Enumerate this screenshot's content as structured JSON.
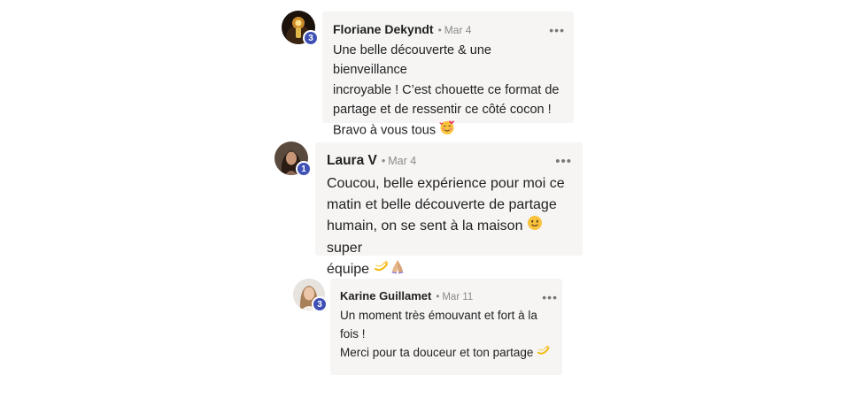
{
  "comments": [
    {
      "author": "Floriane Dekyndt",
      "date": "Mar 4",
      "level": "3",
      "more": "•••",
      "text": "Une belle découverte & une bienveillance\nincroyable ! C’est chouette ce format de\npartage et de ressentir ce côté cocon !\nBravo à vous tous",
      "emoji": "smiling-face-with-hearts-icon"
    },
    {
      "author": "Laura V",
      "date": "Mar 4",
      "level": "1",
      "more": "•••",
      "text_before": "Coucou, belle expérience pour moi ce\nmatin et belle découverte de partage\nhumain, on se sent à la maison ",
      "text_middle": " super\néquipe ",
      "emojis": [
        "slightly-smiling-face-icon",
        "dizzy-icon",
        "folded-hands-icon"
      ]
    },
    {
      "author": "Karine Guillamet",
      "date": "Mar 11",
      "level": "3",
      "more": "•••",
      "text": "Un moment très émouvant et fort à la\nfois !\nMerci pour ta douceur et ton partage ",
      "emoji": "dizzy-icon"
    }
  ],
  "colors": {
    "bubble": "#f6f5f4",
    "badge": "#3f51b5",
    "meta": "#8a8a8a"
  }
}
